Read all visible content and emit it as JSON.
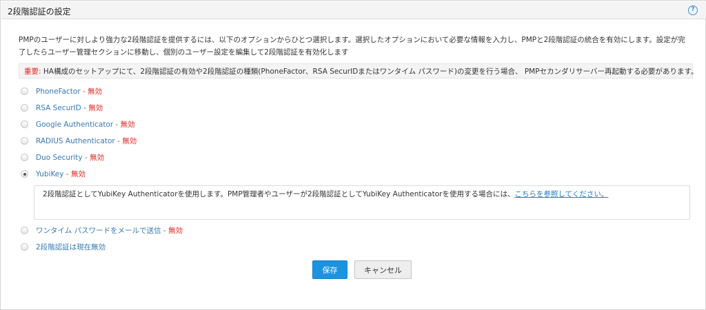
{
  "header": {
    "title": "2段階認証の設定",
    "help_icon": "?"
  },
  "description": "PMPのユーザーに対しより強力な2段階認証を提供するには、以下のオプションからひとつ選択します。選択したオプションにおいて必要な情報を入力し、PMPと2段階認証の統合を有効にします。設定が完了したらユーザー管理セクションに移動し、個別のユーザー設定を編集して2段階認証を有効化します",
  "note": {
    "label": "重要:",
    "text": " HA構成のセットアップにて、2段階認証の有効や2段階認証の種類(PhoneFactor、RSA SecurIDまたはワンタイム パスワード)の変更を行う場合、 PMPセカンダリサーバー再起動する必要があります。"
  },
  "separator": " - ",
  "options": [
    {
      "label": "PhoneFactor",
      "status": "無効"
    },
    {
      "label": "RSA SecurID",
      "status": "無効"
    },
    {
      "label": "Google Authenticator",
      "status": "無効"
    },
    {
      "label": "RADIUS Authenticator",
      "status": "無効"
    },
    {
      "label": "Duo Security",
      "status": "無効"
    },
    {
      "label": "YubiKey",
      "status": "無効"
    },
    {
      "label": "ワンタイム パスワードをメールで送信",
      "status": "無効"
    },
    {
      "label": "2段階認証は現在無効"
    }
  ],
  "selected_option": "YubiKey",
  "info": {
    "text": "2段階認証としてYubiKey Authenticatorを使用します。PMP管理者やユーザーが2段階認証としてYubiKey Authenticatorを使用する場合には、",
    "link": "こちらを参照してください。"
  },
  "buttons": {
    "save": "保存",
    "cancel": "キャンセル"
  },
  "colors": {
    "accent": "#1b93df",
    "status_red": "#e0271f",
    "link_blue": "#3778b4"
  }
}
